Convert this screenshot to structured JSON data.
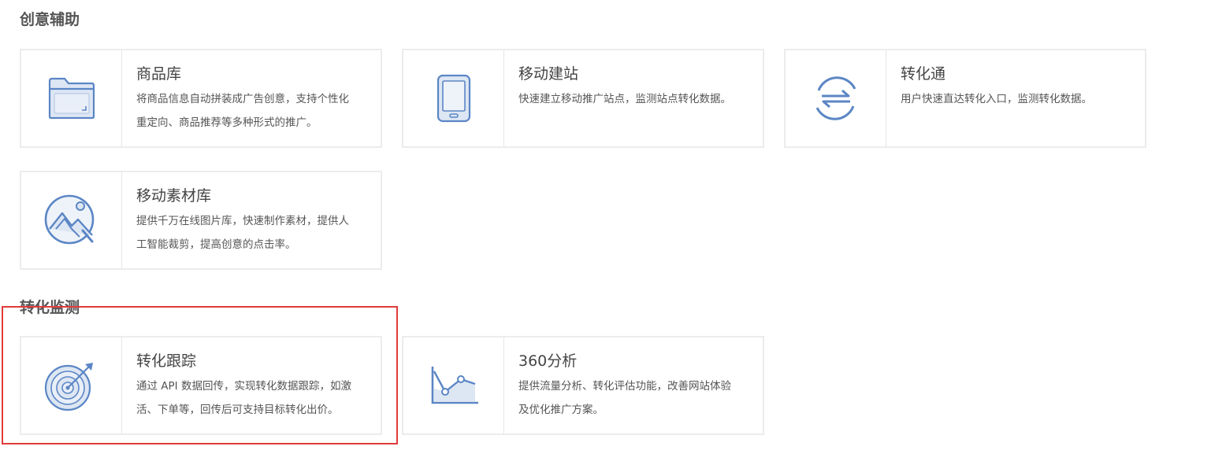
{
  "sections": {
    "creative": {
      "title": "创意辅助"
    },
    "conversion": {
      "title": "转化监测"
    }
  },
  "cards": {
    "product_library": {
      "icon": "folder-icon",
      "title": "商品库",
      "desc_line1": "将商品信息自动拼装成广告创意，支持个性化",
      "desc_line2": "重定向、商品推荐等多种形式的推广。"
    },
    "mobile_site": {
      "icon": "mobile-phone-icon",
      "title": "移动建站",
      "desc_line1": "快速建立移动推广站点，监测站点转化数据。",
      "desc_line2": ""
    },
    "conversion_link": {
      "icon": "swap-arrows-icon",
      "title": "转化通",
      "desc_line1": "用户快速直达转化入口，监测转化数据。",
      "desc_line2": ""
    },
    "mobile_assets": {
      "icon": "image-mountain-icon",
      "title": "移动素材库",
      "desc_line1": "提供千万在线图片库，快速制作素材，提供人",
      "desc_line2": "工智能裁剪，提高创意的点击率。"
    },
    "conversion_tracking": {
      "icon": "target-icon",
      "title": "转化跟踪",
      "desc_line1": "通过 API 数据回传，实现转化数据跟踪，如激",
      "desc_line2": "活、下单等，回传后可支持目标转化出价。"
    },
    "analytics_360": {
      "icon": "line-chart-icon",
      "title": "360分析",
      "desc_line1": "提供流量分析、转化评估功能，改善网站体验",
      "desc_line2": "及优化推广方案。"
    }
  },
  "colors": {
    "icon_blue": "#5b86c5",
    "icon_fill": "#dde6f3",
    "highlight_red": "#e23b3b"
  }
}
